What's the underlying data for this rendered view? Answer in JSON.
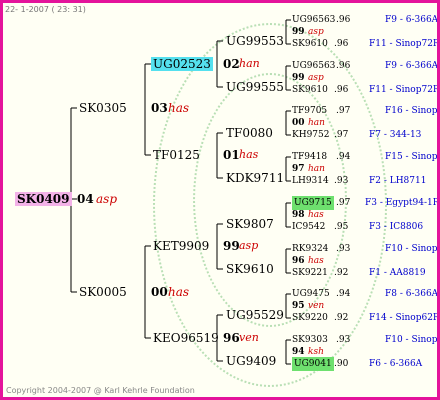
{
  "header": "22- 1-2007 ( 23: 31)",
  "footer": "Copyright 2004-2007 @ Karl Kehrle Foundation",
  "root": {
    "ring": "SK0409",
    "num": "04",
    "race": "asp"
  },
  "gen1": {
    "sire": "SK0305",
    "dam": "SK0005"
  },
  "gen2": [
    {
      "num": "03",
      "race": "has",
      "sire": "UG02523",
      "dam": "TF0125"
    },
    {
      "num": "00",
      "race": "has",
      "sire": "KET9909",
      "dam": "KEO96519"
    }
  ],
  "gen3": [
    {
      "num": "02",
      "race": "han",
      "sire": "UG99553",
      "dam": "UG99555"
    },
    {
      "num": "01",
      "race": "has",
      "sire": "TF0080",
      "dam": "KDK9711"
    },
    {
      "num": "99",
      "race": "asp",
      "sire": "SK9807",
      "dam": "SK9610"
    },
    {
      "num": "96",
      "race": "ven",
      "sire": "UG95529",
      "dam": "UG9409"
    }
  ],
  "gen4": [
    {
      "sire": "UG96563",
      "sire_pct": ".96",
      "num": "99",
      "race": "asp",
      "dam": "SK9610",
      "dam_pct": ".96",
      "sire_src": "F9 - 6-366A",
      "dam_src": "F11 - Sinop72R"
    },
    {
      "sire": "UG96563",
      "sire_pct": ".96",
      "num": "99",
      "race": "asp",
      "dam": "SK9610",
      "dam_pct": ".96",
      "sire_src": "F9 - 6-366A",
      "dam_src": "F11 - Sinop72R"
    },
    {
      "sire": "TF9705",
      "sire_pct": ".97",
      "num": "00",
      "race": "han",
      "dam": "KH9752",
      "dam_pct": ".97",
      "sire_src": "F16 - Sinop62R",
      "dam_src": "F7 - 344-13"
    },
    {
      "sire": "TF9418",
      "sire_pct": ".94",
      "num": "97",
      "race": "han",
      "dam": "LH9314",
      "dam_pct": ".93",
      "sire_src": "F15 - Sinop62R",
      "dam_src": "F2 - LH8711"
    },
    {
      "sire": "UG9715",
      "sire_pct": ".97",
      "num": "98",
      "race": "has",
      "dam": "IC9542",
      "dam_pct": ".95",
      "sire_src": "F3 - Egypt94-1R",
      "dam_src": "F3 - IC8806"
    },
    {
      "sire": "RK9324",
      "sire_pct": ".93",
      "num": "96",
      "race": "has",
      "dam": "SK9221",
      "dam_pct": ".92",
      "sire_src": "F10 - Sinop72R",
      "dam_src": "F1 - AA8819"
    },
    {
      "sire": "UG9475",
      "sire_pct": ".94",
      "num": "95",
      "race": "ven",
      "dam": "SK9220",
      "dam_pct": ".92",
      "sire_src": "F8 - 6-366A",
      "dam_src": "F14 - Sinop62R"
    },
    {
      "sire": "SK9303",
      "sire_pct": ".93",
      "num": "94",
      "race": "ksh",
      "dam": "UG9041",
      "dam_pct": ".90",
      "sire_src": "F10 - Sinop72R",
      "dam_src": "F6 - 6-366A"
    }
  ]
}
